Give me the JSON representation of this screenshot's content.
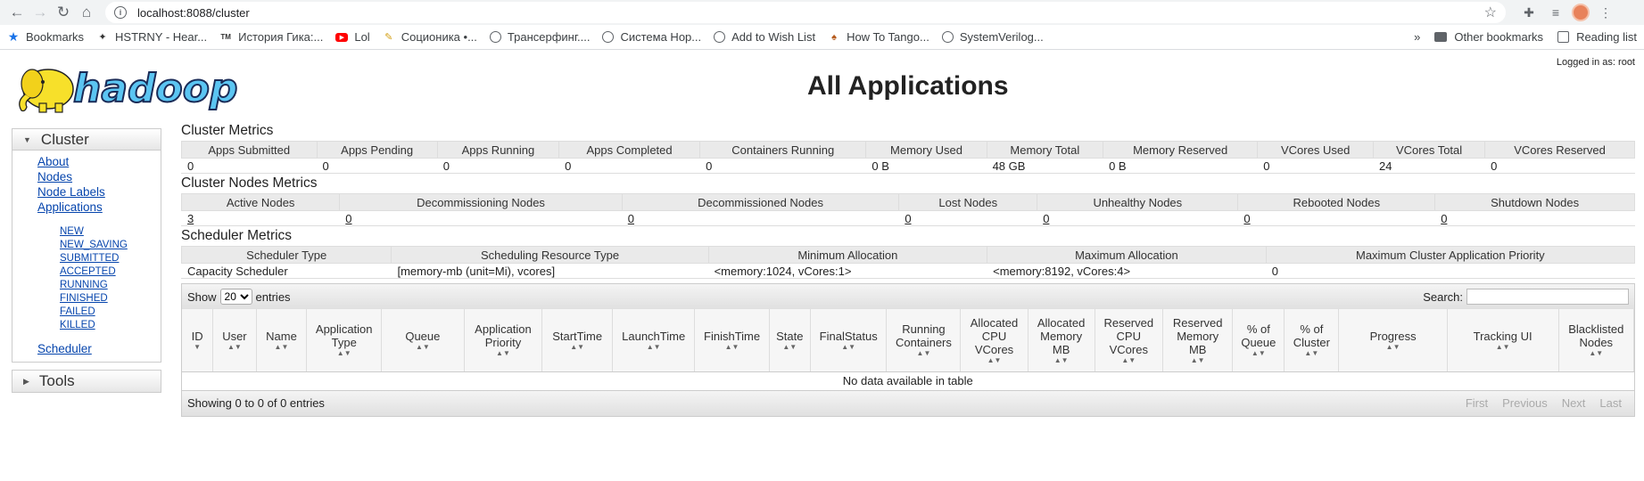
{
  "browser": {
    "url": "localhost:8088/cluster",
    "bookmarks": [
      {
        "label": "Bookmarks",
        "icon": "star-icon"
      },
      {
        "label": "HSTRNY - Hear...",
        "icon": "diamond-icon"
      },
      {
        "label": "История Гика:...",
        "icon": "tm-icon"
      },
      {
        "label": "Lol",
        "icon": "youtube-icon"
      },
      {
        "label": "Соционика •...",
        "icon": "cat-icon"
      },
      {
        "label": "Трансерфинг....",
        "icon": "globe-icon"
      },
      {
        "label": "Система Нор...",
        "icon": "globe-icon"
      },
      {
        "label": "Add to Wish List",
        "icon": "globe-icon"
      },
      {
        "label": "How To Tango...",
        "icon": "hat-icon"
      },
      {
        "label": "SystemVerilog...",
        "icon": "globe-icon"
      }
    ],
    "more": "»",
    "other_bookmarks": "Other bookmarks",
    "reading_list": "Reading list"
  },
  "page": {
    "logged_in": "Logged in as: root",
    "title": "All Applications",
    "logo_text": "hadoop"
  },
  "sidebar": {
    "cluster": {
      "title": "Cluster",
      "links": [
        "About",
        "Nodes",
        "Node Labels",
        "Applications"
      ],
      "app_states": [
        "NEW",
        "NEW_SAVING",
        "SUBMITTED",
        "ACCEPTED",
        "RUNNING",
        "FINISHED",
        "FAILED",
        "KILLED"
      ],
      "scheduler": "Scheduler"
    },
    "tools": {
      "title": "Tools"
    }
  },
  "cluster_metrics": {
    "title": "Cluster Metrics",
    "headers": [
      "Apps Submitted",
      "Apps Pending",
      "Apps Running",
      "Apps Completed",
      "Containers Running",
      "Memory Used",
      "Memory Total",
      "Memory Reserved",
      "VCores Used",
      "VCores Total",
      "VCores Reserved"
    ],
    "values": [
      "0",
      "0",
      "0",
      "0",
      "0",
      "0 B",
      "48 GB",
      "0 B",
      "0",
      "24",
      "0"
    ]
  },
  "nodes_metrics": {
    "title": "Cluster Nodes Metrics",
    "headers": [
      "Active Nodes",
      "Decommissioning Nodes",
      "Decommissioned Nodes",
      "Lost Nodes",
      "Unhealthy Nodes",
      "Rebooted Nodes",
      "Shutdown Nodes"
    ],
    "values": [
      "3",
      "0",
      "0",
      "0",
      "0",
      "0",
      "0"
    ]
  },
  "scheduler_metrics": {
    "title": "Scheduler Metrics",
    "headers": [
      "Scheduler Type",
      "Scheduling Resource Type",
      "Minimum Allocation",
      "Maximum Allocation",
      "Maximum Cluster Application Priority"
    ],
    "values": [
      "Capacity Scheduler",
      "[memory-mb (unit=Mi), vcores]",
      "<memory:1024, vCores:1>",
      "<memory:8192, vCores:4>",
      "0"
    ]
  },
  "apps_table": {
    "show_label": "Show",
    "page_size": "20",
    "entries_label": "entries",
    "search_label": "Search:",
    "columns": [
      "ID",
      "User",
      "Name",
      "Application Type",
      "Queue",
      "Application Priority",
      "StartTime",
      "LaunchTime",
      "FinishTime",
      "State",
      "FinalStatus",
      "Running Containers",
      "Allocated CPU VCores",
      "Allocated Memory MB",
      "Reserved CPU VCores",
      "Reserved Memory MB",
      "% of Queue",
      "% of Cluster",
      "Progress",
      "Tracking UI",
      "Blacklisted Nodes"
    ],
    "empty_message": "No data available in table",
    "info": "Showing 0 to 0 of 0 entries",
    "pager": [
      "First",
      "Previous",
      "Next",
      "Last"
    ]
  }
}
